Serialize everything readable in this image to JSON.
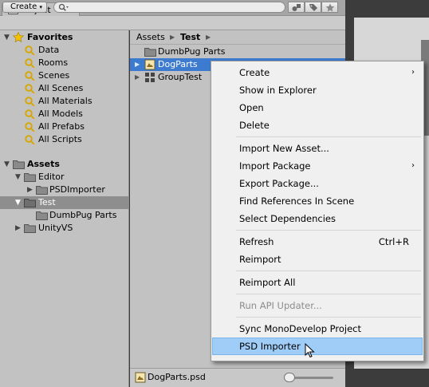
{
  "window": {
    "tab_label": "Project"
  },
  "toolbar": {
    "create_label": "Create",
    "create_caret": "▾"
  },
  "tree": {
    "favorites_label": "Favorites",
    "favorites": [
      "Data",
      "Rooms",
      "Scenes",
      "All Scenes",
      "All Materials",
      "All Models",
      "All Prefabs",
      "All Scripts"
    ],
    "assets_label": "Assets",
    "editor_label": "Editor",
    "psdimporter_label": "PSDImporter",
    "test_label": "Test",
    "dumbpug_label": "DumbPug Parts",
    "unityvs_label": "UnityVS"
  },
  "browser": {
    "breadcrumb": [
      "Assets",
      "Test"
    ],
    "items": [
      "DumbPug Parts",
      "DogParts",
      "GroupTest"
    ],
    "selected_file": "DogParts.psd"
  },
  "context_menu": {
    "items": [
      {
        "label": "Create",
        "submenu": true
      },
      {
        "label": "Show in Explorer"
      },
      {
        "label": "Open"
      },
      {
        "label": "Delete"
      },
      {
        "label": "Import New Asset..."
      },
      {
        "label": "Import Package",
        "submenu": true
      },
      {
        "label": "Export Package..."
      },
      {
        "label": "Find References In Scene"
      },
      {
        "label": "Select Dependencies"
      },
      {
        "label": "Refresh",
        "shortcut": "Ctrl+R"
      },
      {
        "label": "Reimport"
      },
      {
        "label": "Reimport All"
      },
      {
        "label": "Run API Updater...",
        "disabled": true
      },
      {
        "label": "Sync MonoDevelop Project"
      },
      {
        "label": "PSD Importer",
        "highlighted": true
      }
    ],
    "submenu_arrow": "›"
  },
  "colors": {
    "selection_blue": "#3d7bd0",
    "menu_highlight": "#9fcdf7",
    "favorite_star": "#f2c200",
    "search_icon": "#d8a600"
  }
}
